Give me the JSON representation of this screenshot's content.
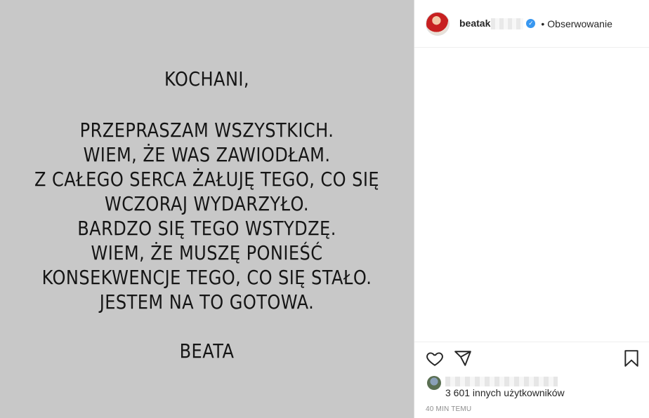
{
  "post": {
    "image_text": {
      "greeting": "KOCHANI,",
      "message_lines": [
        "PRZEPRASZAM WSZYSTKICH.",
        "WIEM, ŻE WAS ZAWIODŁAM.",
        "Z CAŁEGO SERCA ŻAŁUJĘ TEGO, CO SIĘ",
        "WCZORAJ WYDARZYŁO.",
        "BARDZO SIĘ TEGO WSTYDZĘ.",
        "WIEM, ŻE MUSZĘ PONIEŚĆ",
        "KONSEKWENCJE TEGO, CO SIĘ STAŁO.",
        "JESTEM NA TO GOTOWA."
      ],
      "signature": "BEATA"
    },
    "background_color": "#c8c8c8"
  },
  "header": {
    "username": "beatak",
    "verified_icon": "verified-badge-icon",
    "separator": "•",
    "follow_label": "Obserwowanie"
  },
  "footer": {
    "icons": [
      "heart-icon",
      "share-icon",
      "bookmark-icon"
    ],
    "likes_text": "3 601 innych użytkowników",
    "timestamp": "40 MIN TEMU"
  },
  "colors": {
    "verified": "#3897f0",
    "text": "#262626",
    "muted": "#8e8e8e"
  }
}
